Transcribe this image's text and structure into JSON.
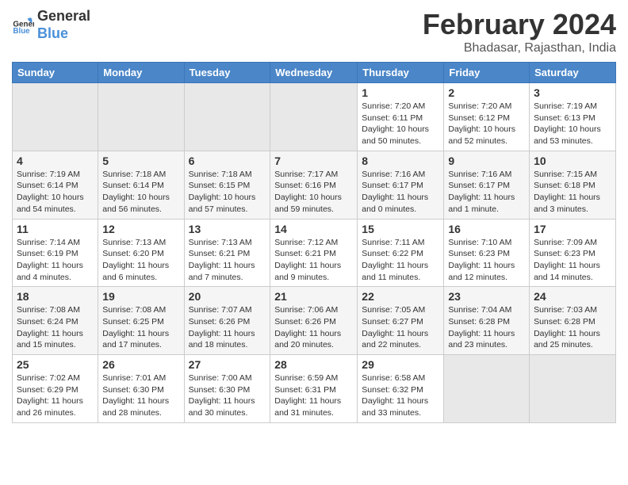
{
  "logo": {
    "general": "General",
    "blue": "Blue"
  },
  "header": {
    "title": "February 2024",
    "subtitle": "Bhadasar, Rajasthan, India"
  },
  "weekdays": [
    "Sunday",
    "Monday",
    "Tuesday",
    "Wednesday",
    "Thursday",
    "Friday",
    "Saturday"
  ],
  "weeks": [
    [
      {
        "day": "",
        "empty": true
      },
      {
        "day": "",
        "empty": true
      },
      {
        "day": "",
        "empty": true
      },
      {
        "day": "",
        "empty": true
      },
      {
        "day": "1",
        "rise": "7:20 AM",
        "set": "6:11 PM",
        "daylight": "10 hours and 50 minutes."
      },
      {
        "day": "2",
        "rise": "7:20 AM",
        "set": "6:12 PM",
        "daylight": "10 hours and 52 minutes."
      },
      {
        "day": "3",
        "rise": "7:19 AM",
        "set": "6:13 PM",
        "daylight": "10 hours and 53 minutes."
      }
    ],
    [
      {
        "day": "4",
        "rise": "7:19 AM",
        "set": "6:14 PM",
        "daylight": "10 hours and 54 minutes."
      },
      {
        "day": "5",
        "rise": "7:18 AM",
        "set": "6:14 PM",
        "daylight": "10 hours and 56 minutes."
      },
      {
        "day": "6",
        "rise": "7:18 AM",
        "set": "6:15 PM",
        "daylight": "10 hours and 57 minutes."
      },
      {
        "day": "7",
        "rise": "7:17 AM",
        "set": "6:16 PM",
        "daylight": "10 hours and 59 minutes."
      },
      {
        "day": "8",
        "rise": "7:16 AM",
        "set": "6:17 PM",
        "daylight": "11 hours and 0 minutes."
      },
      {
        "day": "9",
        "rise": "7:16 AM",
        "set": "6:17 PM",
        "daylight": "11 hours and 1 minute."
      },
      {
        "day": "10",
        "rise": "7:15 AM",
        "set": "6:18 PM",
        "daylight": "11 hours and 3 minutes."
      }
    ],
    [
      {
        "day": "11",
        "rise": "7:14 AM",
        "set": "6:19 PM",
        "daylight": "11 hours and 4 minutes."
      },
      {
        "day": "12",
        "rise": "7:13 AM",
        "set": "6:20 PM",
        "daylight": "11 hours and 6 minutes."
      },
      {
        "day": "13",
        "rise": "7:13 AM",
        "set": "6:21 PM",
        "daylight": "11 hours and 7 minutes."
      },
      {
        "day": "14",
        "rise": "7:12 AM",
        "set": "6:21 PM",
        "daylight": "11 hours and 9 minutes."
      },
      {
        "day": "15",
        "rise": "7:11 AM",
        "set": "6:22 PM",
        "daylight": "11 hours and 11 minutes."
      },
      {
        "day": "16",
        "rise": "7:10 AM",
        "set": "6:23 PM",
        "daylight": "11 hours and 12 minutes."
      },
      {
        "day": "17",
        "rise": "7:09 AM",
        "set": "6:23 PM",
        "daylight": "11 hours and 14 minutes."
      }
    ],
    [
      {
        "day": "18",
        "rise": "7:08 AM",
        "set": "6:24 PM",
        "daylight": "11 hours and 15 minutes."
      },
      {
        "day": "19",
        "rise": "7:08 AM",
        "set": "6:25 PM",
        "daylight": "11 hours and 17 minutes."
      },
      {
        "day": "20",
        "rise": "7:07 AM",
        "set": "6:26 PM",
        "daylight": "11 hours and 18 minutes."
      },
      {
        "day": "21",
        "rise": "7:06 AM",
        "set": "6:26 PM",
        "daylight": "11 hours and 20 minutes."
      },
      {
        "day": "22",
        "rise": "7:05 AM",
        "set": "6:27 PM",
        "daylight": "11 hours and 22 minutes."
      },
      {
        "day": "23",
        "rise": "7:04 AM",
        "set": "6:28 PM",
        "daylight": "11 hours and 23 minutes."
      },
      {
        "day": "24",
        "rise": "7:03 AM",
        "set": "6:28 PM",
        "daylight": "11 hours and 25 minutes."
      }
    ],
    [
      {
        "day": "25",
        "rise": "7:02 AM",
        "set": "6:29 PM",
        "daylight": "11 hours and 26 minutes."
      },
      {
        "day": "26",
        "rise": "7:01 AM",
        "set": "6:30 PM",
        "daylight": "11 hours and 28 minutes."
      },
      {
        "day": "27",
        "rise": "7:00 AM",
        "set": "6:30 PM",
        "daylight": "11 hours and 30 minutes."
      },
      {
        "day": "28",
        "rise": "6:59 AM",
        "set": "6:31 PM",
        "daylight": "11 hours and 31 minutes."
      },
      {
        "day": "29",
        "rise": "6:58 AM",
        "set": "6:32 PM",
        "daylight": "11 hours and 33 minutes."
      },
      {
        "day": "",
        "empty": true
      },
      {
        "day": "",
        "empty": true
      }
    ]
  ],
  "labels": {
    "sunrise": "Sunrise:",
    "sunset": "Sunset:",
    "daylight": "Daylight:"
  }
}
